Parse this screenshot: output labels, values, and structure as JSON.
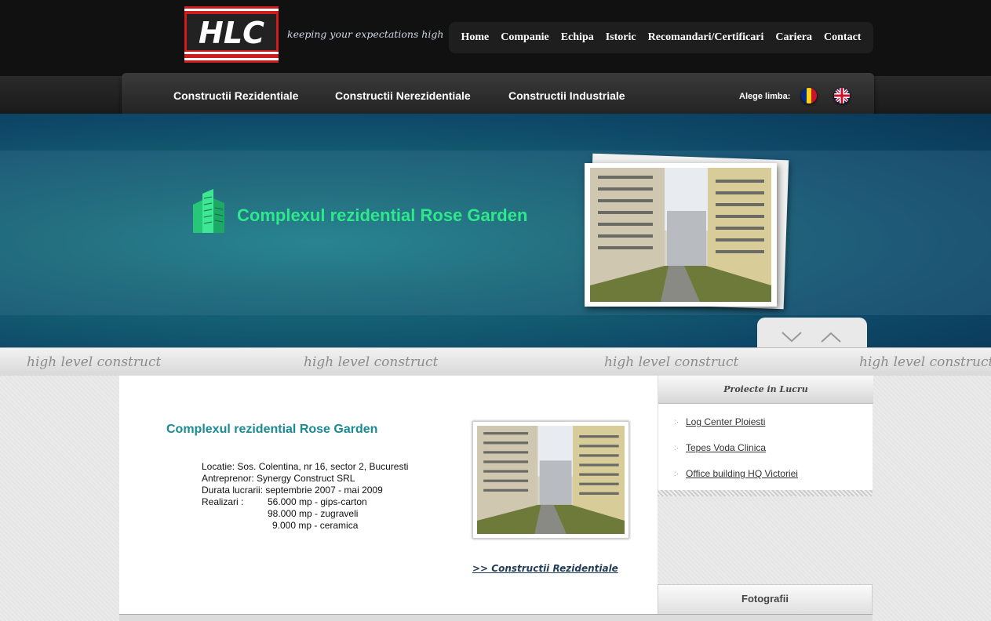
{
  "brand": {
    "logo_text": "HLC",
    "tagline": "keeping your expectations high"
  },
  "top_nav": [
    "Home",
    "Companie",
    "Echipa",
    "Istoric",
    "Recomandari/Certificari",
    "Cariera",
    "Contact"
  ],
  "category_nav": [
    "Constructii Rezidentiale",
    "Constructii Nerezidentiale",
    "Constructii Industriale"
  ],
  "language": {
    "label": "Alege limba:",
    "options": [
      "romanian-flag-icon",
      "uk-flag-icon"
    ]
  },
  "hero": {
    "title": "Complexul rezidential Rose Garden",
    "icon": "building-icon"
  },
  "stripe_text": "high level construct",
  "project": {
    "title": "Complexul rezidential Rose Garden",
    "lines": [
      "Locatie: Sos. Colentina, nr 16, sector 2, Bucuresti",
      "Antreprenor: Synergy Construct SRL",
      "Durata lucrarii: septembrie 2007 - mai 2009"
    ],
    "realizari_label": "Realizari :",
    "realizari": [
      "56.000 mp - gips-carton",
      "98.000 mp - zugraveli",
      "9.000 mp - ceramica"
    ],
    "back_link": ">> Constructii Rezidentiale"
  },
  "sidebar": {
    "title": "Proiecte in Lucru",
    "items": [
      "Log Center Ploiesti",
      "Tepes Voda Clinica",
      "Office building HQ Victoriei"
    ],
    "photos_title": "Fotografii"
  },
  "colors": {
    "accent_green": "#2ee88a",
    "title_teal": "#1a8a94",
    "hero_blue": "#0e4868"
  }
}
